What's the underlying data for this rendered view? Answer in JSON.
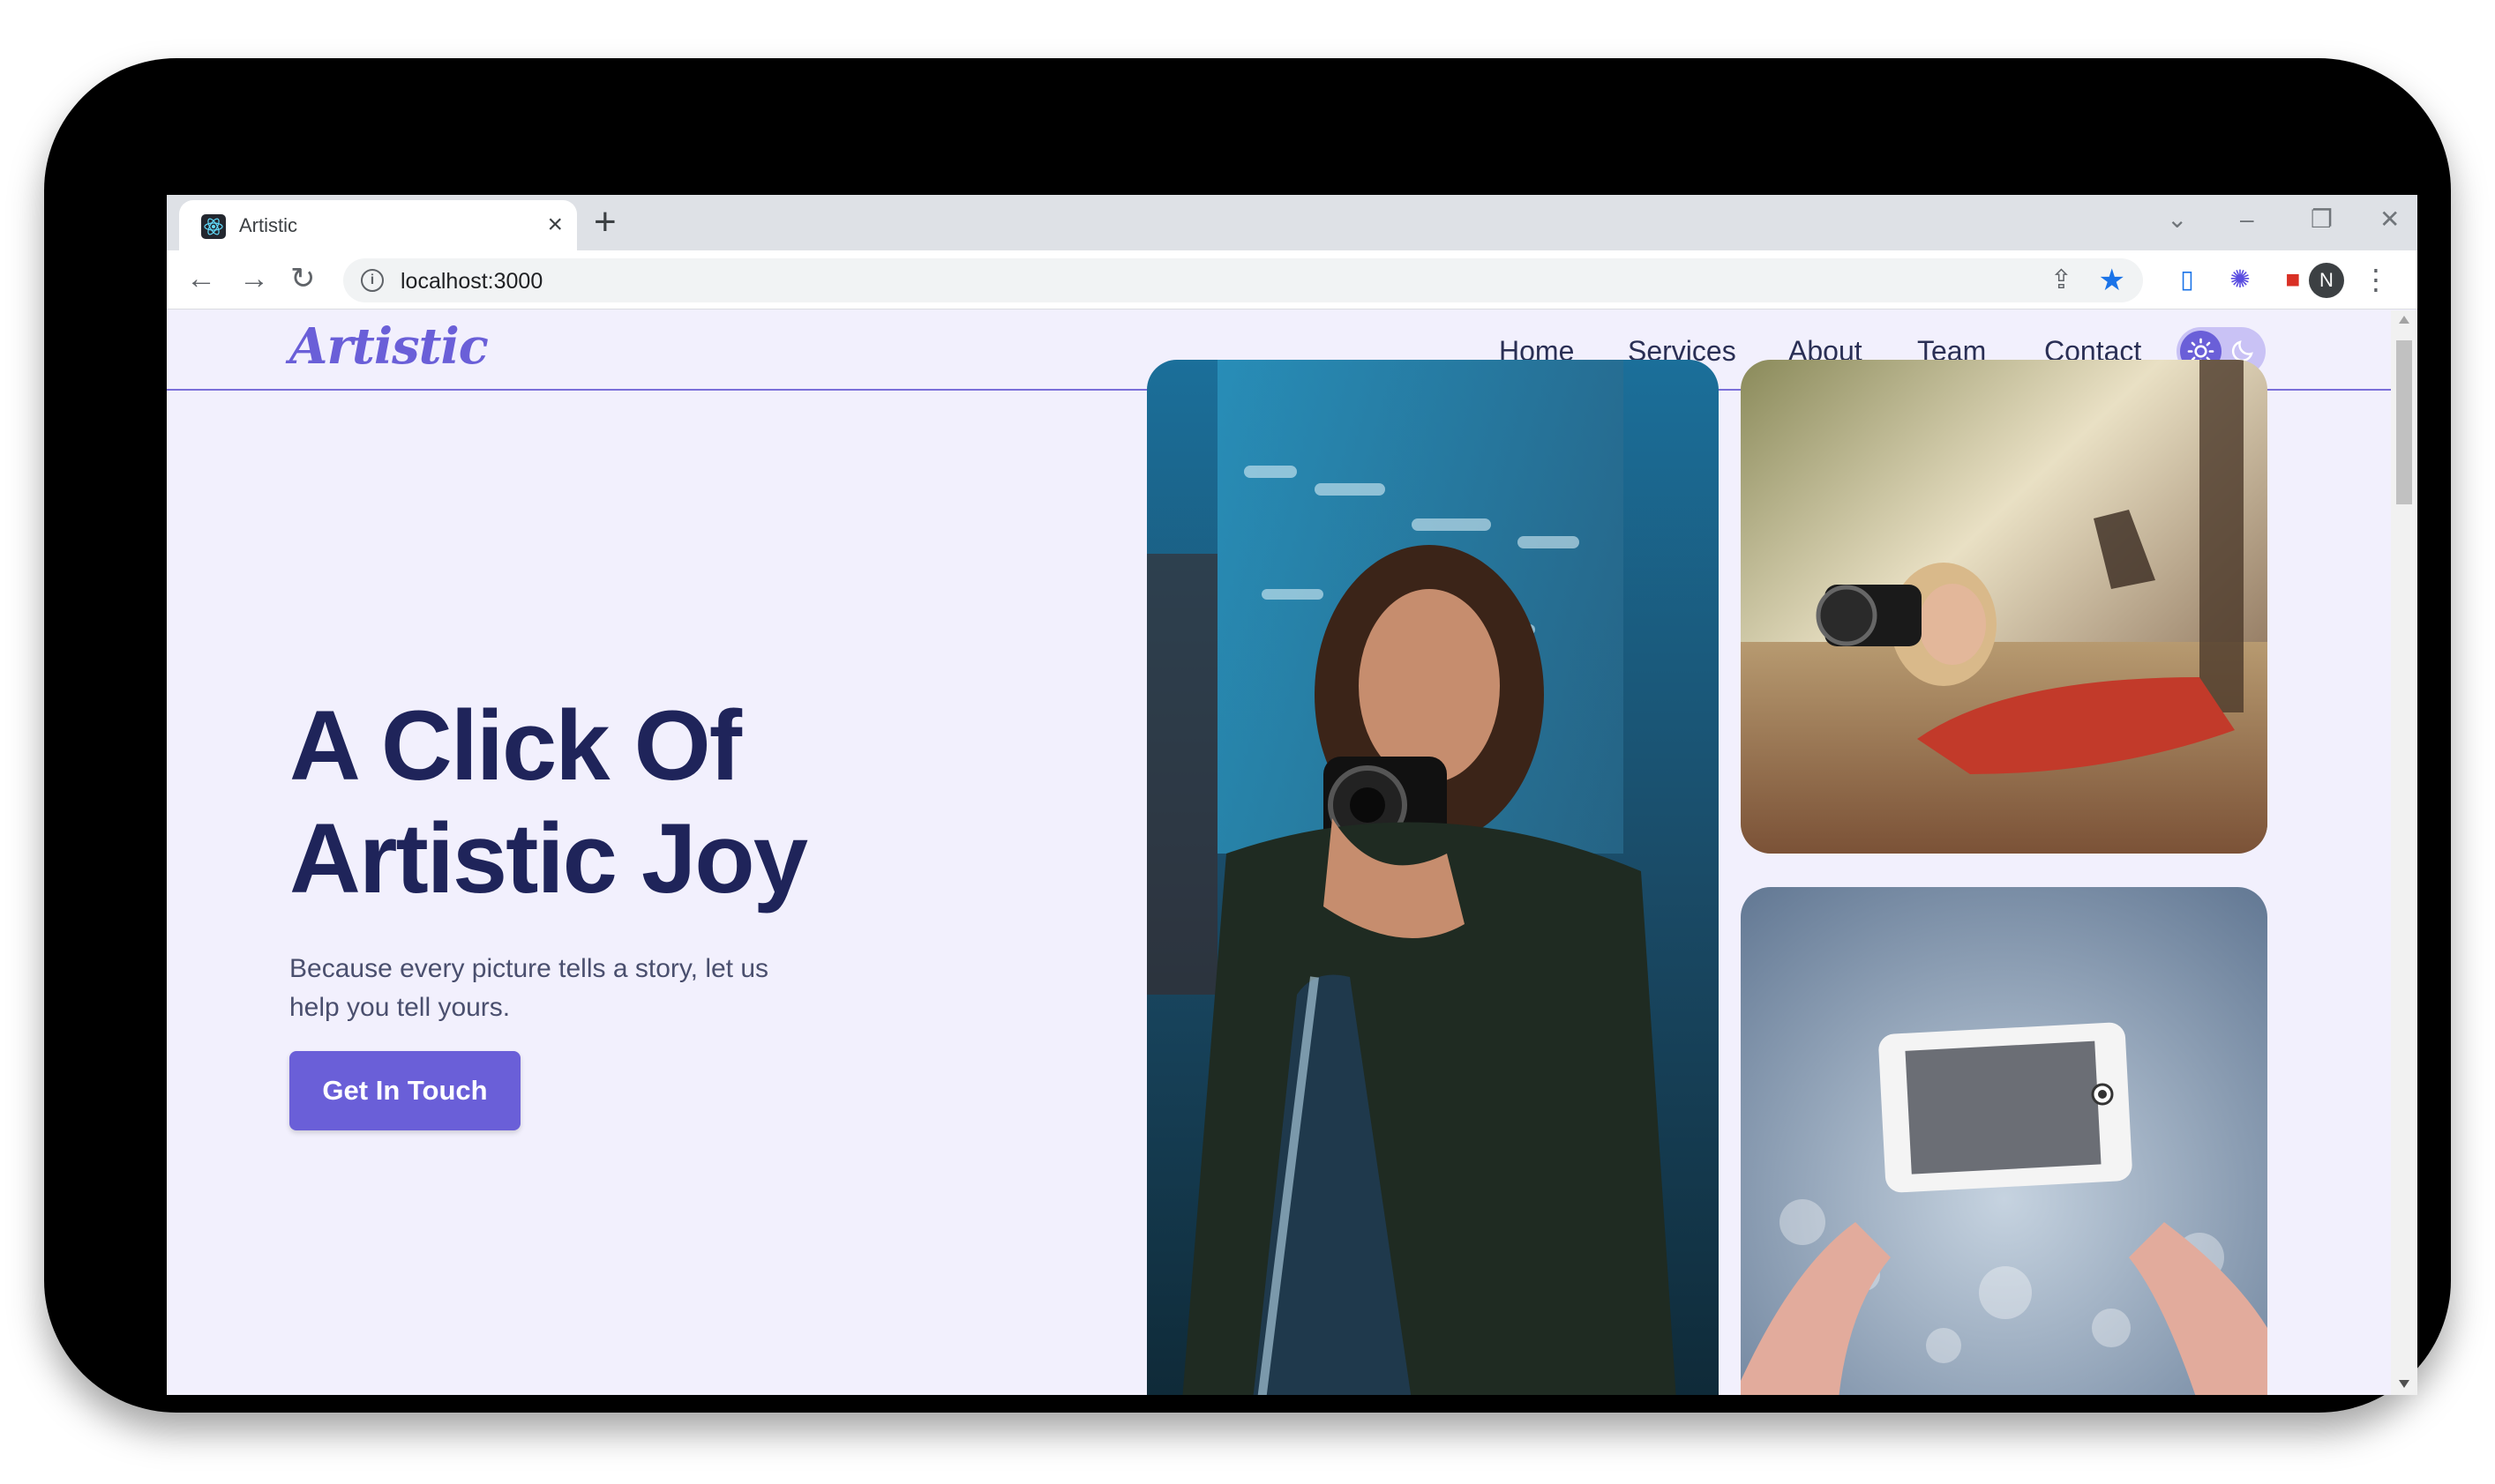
{
  "browser": {
    "tab_title": "Artistic",
    "url": "localhost:3000",
    "avatar_letter": "N",
    "icons": {
      "back": "arrow-left-icon",
      "forward": "arrow-right-icon",
      "reload": "reload-icon",
      "new_tab": "plus-icon",
      "share": "share-icon",
      "bookmark": "star-icon",
      "menu": "kebab-icon"
    }
  },
  "site": {
    "logo": "Artistic",
    "nav": [
      "Home",
      "Services",
      "About",
      "Team",
      "Contact"
    ],
    "active_nav": "Home",
    "hero": {
      "title_line1": "A Click Of",
      "title_line2": "Artistic Joy",
      "subtitle": "Because every picture tells a story, let us help you tell yours.",
      "cta": "Get In Touch"
    },
    "colors": {
      "accent": "#6a5fd8",
      "heading": "#1f245a",
      "background": "#f2f0fd"
    }
  }
}
